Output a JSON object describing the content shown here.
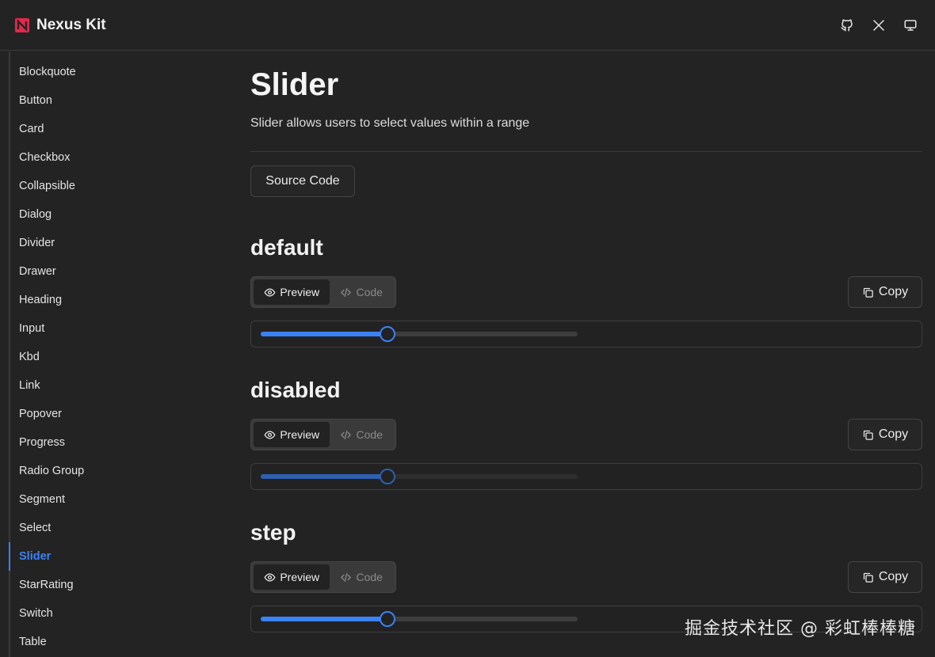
{
  "header": {
    "brand_name": "Nexus Kit",
    "icons": [
      "github-icon",
      "x-icon",
      "monitor-icon"
    ],
    "brand_color": "#e5284a"
  },
  "sidebar": {
    "items": [
      {
        "label": "Blockquote"
      },
      {
        "label": "Button"
      },
      {
        "label": "Card"
      },
      {
        "label": "Checkbox"
      },
      {
        "label": "Collapsible"
      },
      {
        "label": "Dialog"
      },
      {
        "label": "Divider"
      },
      {
        "label": "Drawer"
      },
      {
        "label": "Heading"
      },
      {
        "label": "Input"
      },
      {
        "label": "Kbd"
      },
      {
        "label": "Link"
      },
      {
        "label": "Popover"
      },
      {
        "label": "Progress"
      },
      {
        "label": "Radio Group"
      },
      {
        "label": "Segment"
      },
      {
        "label": "Select"
      },
      {
        "label": "Slider",
        "active": true
      },
      {
        "label": "StarRating"
      },
      {
        "label": "Switch"
      },
      {
        "label": "Table"
      }
    ],
    "active_color": "#3b82f6"
  },
  "main": {
    "title": "Slider",
    "description": "Slider allows users to select values within a range",
    "source_button": "Source Code",
    "sections": [
      {
        "heading": "default",
        "preview_tab": "Preview",
        "code_tab": "Code",
        "copy_label": "Copy",
        "slider_value_percent": 40,
        "disabled": false
      },
      {
        "heading": "disabled",
        "preview_tab": "Preview",
        "code_tab": "Code",
        "copy_label": "Copy",
        "slider_value_percent": 40,
        "disabled": true
      },
      {
        "heading": "step",
        "preview_tab": "Preview",
        "code_tab": "Code",
        "copy_label": "Copy",
        "slider_value_percent": 40,
        "disabled": false
      }
    ]
  },
  "watermark": "掘金技术社区 @ 彩虹棒棒糖"
}
